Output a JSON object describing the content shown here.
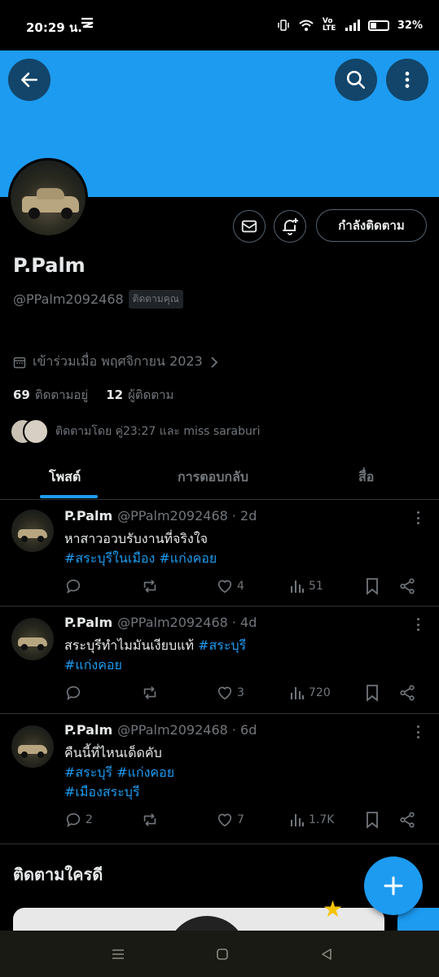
{
  "status_bar": {
    "time": "20:29 น.",
    "notification_icon": "tiktok-icon",
    "battery": "32%",
    "network": "Vo LTE"
  },
  "header": {
    "back_icon": "arrow-left-icon",
    "search_icon": "search-icon",
    "more_icon": "more-vertical-icon",
    "banner_color": "#1d9bf0"
  },
  "profile": {
    "name": "P.Palm",
    "handle": "@PPalm2092468",
    "follows_you": "ติดตามคุณ",
    "joined": "เข้าร่วมเมื่อ พฤศจิกายน 2023",
    "following_count": "69",
    "following_label": "ติดตามอยู่",
    "followers_count": "12",
    "followers_label": "ผู้ติดตาม",
    "followed_by": "ติดตามโดย คู่23:27 และ miss saraburi",
    "follow_button": "กำลังติดตาม"
  },
  "tabs": [
    {
      "label": "โพสต์",
      "active": true
    },
    {
      "label": "การตอบกลับ",
      "active": false
    },
    {
      "label": "สื่อ",
      "active": false
    }
  ],
  "posts": [
    {
      "name": "P.Palm",
      "handle": "@PPalm2092468 · 2d",
      "text": "หาสาวอวบรับงานที่จริงใจ",
      "tags_line1": "#สระบุรีในเมือง #แก่งคอย",
      "tags_line2": "",
      "replies": "",
      "likes": "4",
      "views": "51"
    },
    {
      "name": "P.Palm",
      "handle": "@PPalm2092468 · 4d",
      "text": "สระบุรีทำไมมันเงียบแท้",
      "text_tag": "#สระบุรี",
      "tags_line1": "#แก่งคอย",
      "replies": "",
      "likes": "3",
      "views": "720"
    },
    {
      "name": "P.Palm",
      "handle": "@PPalm2092468 · 6d",
      "text": "คืนนี้ที่ไหนเด็ดคับ",
      "tags_line1": "#สระบุรี #แก่งคอย",
      "tags_line2": "#เมืองสระบุรี",
      "replies": "2",
      "likes": "7",
      "views": "1.7K"
    }
  ],
  "who_to_follow": "ติดตามใครดี",
  "fab_icon": "plus-icon",
  "nav": [
    "menu-icon",
    "home-square-icon",
    "back-triangle-icon"
  ]
}
